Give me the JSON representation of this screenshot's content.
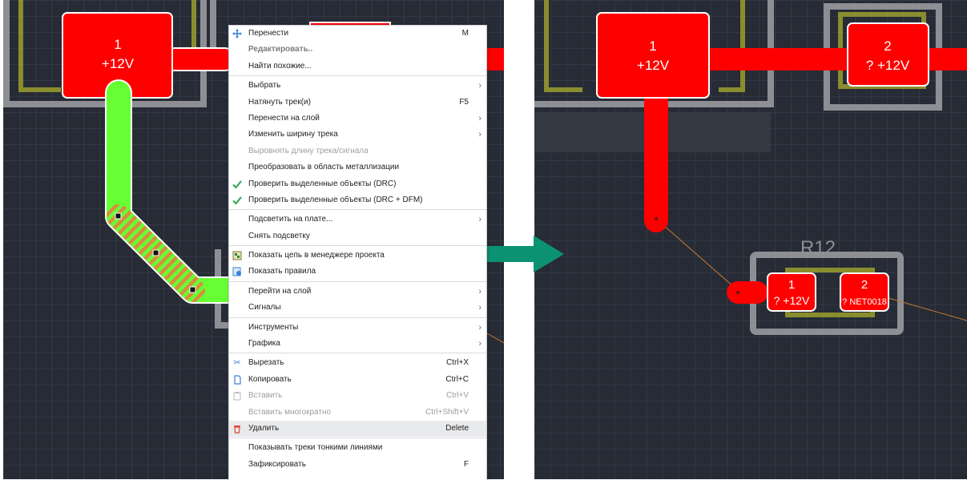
{
  "left_board": {
    "pad1": {
      "number": "1",
      "net": "+12V"
    }
  },
  "right_board": {
    "pad1": {
      "number": "1",
      "net": "+12V"
    },
    "pad2": {
      "number": "2",
      "net": "? +12V"
    },
    "refdes": "R12",
    "r12_pad1": {
      "number": "1",
      "net": "? +12V"
    },
    "r12_pad2": {
      "number": "2",
      "net": "? NET0018"
    }
  },
  "colors": {
    "copper": "#ff0000",
    "selected_track": "#66ff33",
    "hatch": "#d98c40",
    "outline": "#8d8f94",
    "silk": "#8a8d2e",
    "arrow": "#0b9273",
    "ratsnest": "#c77a30"
  },
  "menu": {
    "items": [
      {
        "label": "Перенести",
        "shortcut": "M",
        "icon": "move-icon"
      },
      {
        "label": "Редактировать..",
        "style": "bold"
      },
      {
        "label": "Найти похожие..."
      },
      {
        "separator": true
      },
      {
        "label": "Выбрать",
        "submenu": true
      },
      {
        "label": "Натянуть трек(и)",
        "shortcut": "F5"
      },
      {
        "label": "Перенести на слой",
        "submenu": true
      },
      {
        "label": "Изменить ширину трека",
        "submenu": true
      },
      {
        "label": "Выровнять длину трека/сигнала",
        "disabled": true
      },
      {
        "label": "Преобразовать в область металлизации"
      },
      {
        "label": "Проверить выделенные объекты (DRC)",
        "icon": "checkmark-icon"
      },
      {
        "label": "Проверить выделенные объекты (DRC + DFM)",
        "icon": "checkmark-icon"
      },
      {
        "separator": true
      },
      {
        "label": "Подсветить на плате...",
        "submenu": true
      },
      {
        "label": "Снять подсветку"
      },
      {
        "separator": true
      },
      {
        "label": "Показать цепь в менеджере проекта",
        "icon": "net-manager-icon"
      },
      {
        "label": "Показать правила",
        "icon": "rules-icon"
      },
      {
        "separator": true
      },
      {
        "label": "Перейти на слой",
        "submenu": true
      },
      {
        "label": "Сигналы",
        "submenu": true
      },
      {
        "separator": true
      },
      {
        "label": "Инструменты",
        "submenu": true
      },
      {
        "label": "Графика",
        "submenu": true
      },
      {
        "separator": true
      },
      {
        "label": "Вырезать",
        "shortcut": "Ctrl+X",
        "icon": "scissors-icon"
      },
      {
        "label": "Копировать",
        "shortcut": "Ctrl+C",
        "icon": "copy-icon"
      },
      {
        "label": "Вставить",
        "shortcut": "Ctrl+V",
        "icon": "paste-icon",
        "disabled": true
      },
      {
        "label": "Вставить многократно",
        "shortcut": "Ctrl+Shift+V",
        "disabled": true
      },
      {
        "label": "Удалить",
        "shortcut": "Delete",
        "icon": "trash-icon",
        "highlighted": true
      },
      {
        "separator": true
      },
      {
        "label": "Показывать треки тонкими линиями"
      },
      {
        "label": "Зафиксировать",
        "shortcut": "F"
      }
    ]
  }
}
